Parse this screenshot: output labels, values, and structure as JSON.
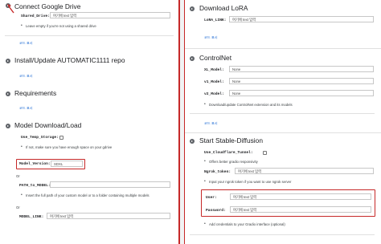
{
  "left": {
    "connect_drive": {
      "title": "Connect Google Drive",
      "shared_drive_label": "Shared_Drive:",
      "shared_drive_placeholder": "여기에 text 입력",
      "hint": "Leave empty if you're not using a shared drive",
      "code_link": "코드 표시"
    },
    "install": {
      "title": "Install/Update AUTOMATIC1111 repo",
      "code_link": "코드 표시"
    },
    "requirements": {
      "title": "Requirements",
      "code_link": "코드 표시"
    },
    "model_download": {
      "title": "Model Download/Load",
      "temp_storage_label": "Use_Temp_Storage:",
      "temp_storage_hint": "If not, make sure you have enough space on your gdrive",
      "model_version_label": "Model_Version:",
      "model_version_value": "SDXL",
      "or1": "Or",
      "path_label": "PATH_to_MODEL:",
      "path_hint": "Insert the full path of your custom model or to a folder containing multiple models",
      "or2": "Or",
      "model_link_label": "MODEL_LINK:",
      "model_link_placeholder": "여기에 text 입력"
    }
  },
  "right": {
    "lora": {
      "title": "Download LoRA",
      "lora_link_label": "LoRA_LINK:",
      "lora_link_placeholder": "여기에 text 입력",
      "code_link": "코드 표시"
    },
    "controlnet": {
      "title": "ControlNet",
      "xl_label": "XL_Model:",
      "xl_value": "None",
      "v1_label": "v1_Model:",
      "v1_value": "None",
      "v2_label": "v2_Model:",
      "v2_value": "None",
      "hint": "Download/update ControlNet extension and its models",
      "code_link": "코드 표시"
    },
    "start": {
      "title": "Start Stable-Diffusion",
      "cloudflare_label": "Use_Cloudflare_Tunnel:",
      "cloudflare_hint": "Offers better gradio responsivity",
      "ngrok_label": "Ngrok_token:",
      "ngrok_placeholder": "여기에 text 입력",
      "ngrok_hint": "Input your ngrok token if you want to use ngrok server",
      "user_label": "User:",
      "user_placeholder": "여기에 text 입력",
      "password_label": "Password:",
      "password_placeholder": "여기에 text 입력",
      "cred_hint": "Add credentials to your Gradio interface (optional)"
    }
  },
  "colors": {
    "highlight": "#c62828",
    "link": "#1967d2"
  }
}
